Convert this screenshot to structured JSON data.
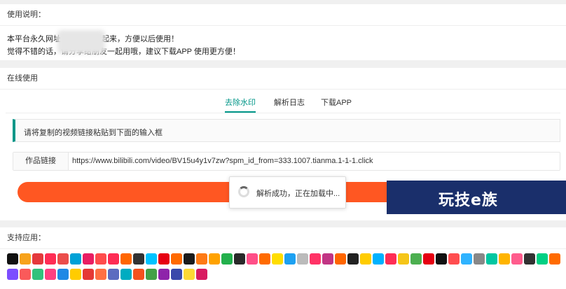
{
  "instructions": {
    "title": "使用说明：",
    "line1": "本平台永久网址：               记得收藏起来，方便以后使用！",
    "line2": "觉得不错的话，请分享给朋友一起用哦，建议下载APP 使用更方便！"
  },
  "online": {
    "title": "在线使用",
    "tabs": [
      {
        "label": "去除水印"
      },
      {
        "label": "解析日志"
      },
      {
        "label": "下载APP"
      }
    ],
    "tip": "请将复制的视频链接粘贴到下面的输入框",
    "input_label": "作品链接",
    "input_value": "https://www.bilibili.com/video/BV15u4y1v7zw?spm_id_from=333.1007.tianma.1-1-1.click",
    "loading": "解析成功，正在加载中..."
  },
  "watermark": {
    "text": "玩技e族"
  },
  "apps": {
    "title": "支持应用：",
    "colors": [
      "#111111",
      "#f7a21b",
      "#e4393c",
      "#ff2d55",
      "#eb4d4b",
      "#00a1d6",
      "#e91e63",
      "#ff4c4c",
      "#fe2c55",
      "#ff6600",
      "#333333",
      "#00c3ff",
      "#e60012",
      "#ff6a00",
      "#1c1c1c",
      "#fe7a15",
      "#ffa200",
      "#23b04c",
      "#2a2a2a",
      "#ff4f88",
      "#ff6b00",
      "#ffdd00",
      "#1da1f2",
      "#bbbbbb",
      "#ff3366",
      "#c13584",
      "#ff6600",
      "#222222",
      "#ffcc00",
      "#00b2ff",
      "#ff2d55",
      "#f5c518",
      "#4caf50",
      "#e60012",
      "#111111",
      "#ff4d4f",
      "#2fb3ff",
      "#888888",
      "#00c7a2",
      "#ffb400",
      "#ff5c8d",
      "#333333",
      "#00d084",
      "#ff6b00",
      "#7c4dff",
      "#fa5a5a",
      "#31c27c",
      "#ff4081",
      "#1e88e5",
      "#ffcc00",
      "#e53935",
      "#ff7043",
      "#5c6bc0",
      "#00acc1",
      "#f4511e",
      "#43a047",
      "#8e24aa",
      "#3949ab",
      "#fdd835",
      "#d81b60"
    ]
  }
}
